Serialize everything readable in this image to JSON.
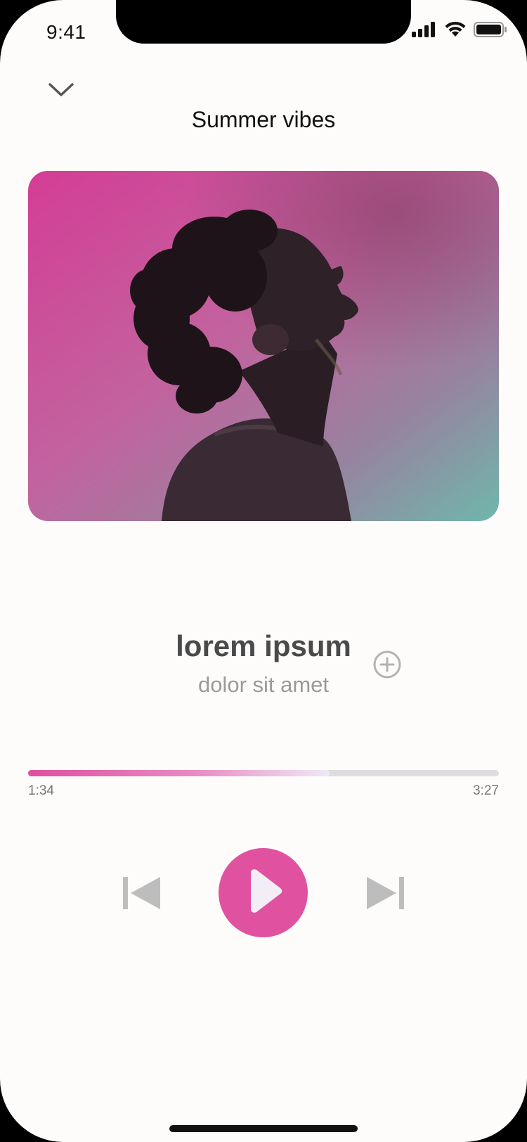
{
  "status_bar": {
    "time": "9:41",
    "icons": [
      "cellular-signal-icon",
      "wifi-icon",
      "battery-icon"
    ]
  },
  "header": {
    "collapse_icon": "chevron-down-icon",
    "title": "Summer vibes"
  },
  "cover": {
    "subject": "portrait of man in profile looking up",
    "colors": {
      "top_left": "#d43d95",
      "bottom_right": "#6fb7ab"
    }
  },
  "track": {
    "title": "lorem ipsum",
    "artist": "dolor sit amet",
    "add_icon": "plus-circle-icon"
  },
  "progress": {
    "elapsed": "1:34",
    "total": "3:27",
    "fraction": 0.64
  },
  "controls": {
    "previous_icon": "skip-previous-icon",
    "play_icon": "play-icon",
    "next_icon": "skip-next-icon"
  },
  "colors": {
    "accent": "#e0529f",
    "background": "#fdfcfb",
    "control_gray": "#bdbdbd",
    "text_dark": "#4a4a4a",
    "text_muted": "#9a9a9a"
  }
}
